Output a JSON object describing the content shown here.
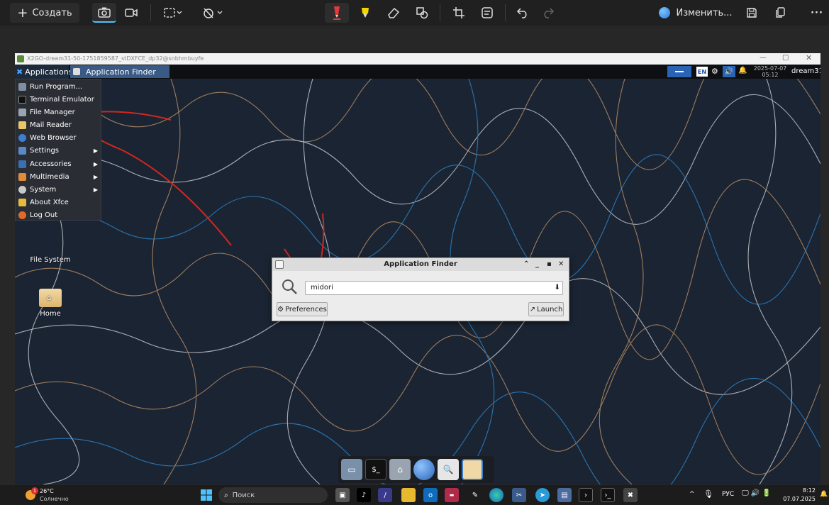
{
  "snip_toolbar": {
    "new_label": "Создать",
    "edit_label": "Изменить...",
    "more_icon": "ellipsis-icon"
  },
  "vm_window": {
    "title": "X2GO-dream31-50-1751859587_stDXFCE_dp32@snbhmbuyfe"
  },
  "xfce_panel": {
    "applications_label": "Applications",
    "task_label": "Application Finder",
    "lang": "EN",
    "date": "2025-07-07",
    "time": "05:12",
    "user": "dream31"
  },
  "app_menu": {
    "items": [
      {
        "label": "Run Program...",
        "icon": "run-icon"
      },
      {
        "label": "Terminal Emulator",
        "icon": "terminal-icon"
      },
      {
        "label": "File Manager",
        "icon": "folder-icon"
      },
      {
        "label": "Mail Reader",
        "icon": "mail-icon"
      },
      {
        "label": "Web Browser",
        "icon": "globe-icon"
      },
      {
        "label": "Settings",
        "icon": "settings-icon",
        "submenu": true
      },
      {
        "label": "Accessories",
        "icon": "accessories-icon",
        "submenu": true
      },
      {
        "label": "Multimedia",
        "icon": "multimedia-icon",
        "submenu": true
      },
      {
        "label": "System",
        "icon": "system-icon",
        "submenu": true
      },
      {
        "label": "About Xfce",
        "icon": "star-icon"
      },
      {
        "label": "Log Out",
        "icon": "logout-icon"
      }
    ]
  },
  "desktop_icons": [
    {
      "label": "File System"
    },
    {
      "label": "Home"
    }
  ],
  "app_finder": {
    "title": "Application Finder",
    "search_value": "midori",
    "preferences_label": "Preferences",
    "launch_label": "Launch"
  },
  "taskbar": {
    "weather_temp": "26°C",
    "weather_desc": "Солнечно",
    "search_placeholder": "Поиск",
    "lang": "РУС",
    "time": "8:12",
    "date": "07.07.2025",
    "weather_badge": "1"
  },
  "colors": {
    "accent_blue": "#1e6fd0",
    "annotation_red": "#d0281e",
    "desktop_bg": "#1b2433"
  }
}
